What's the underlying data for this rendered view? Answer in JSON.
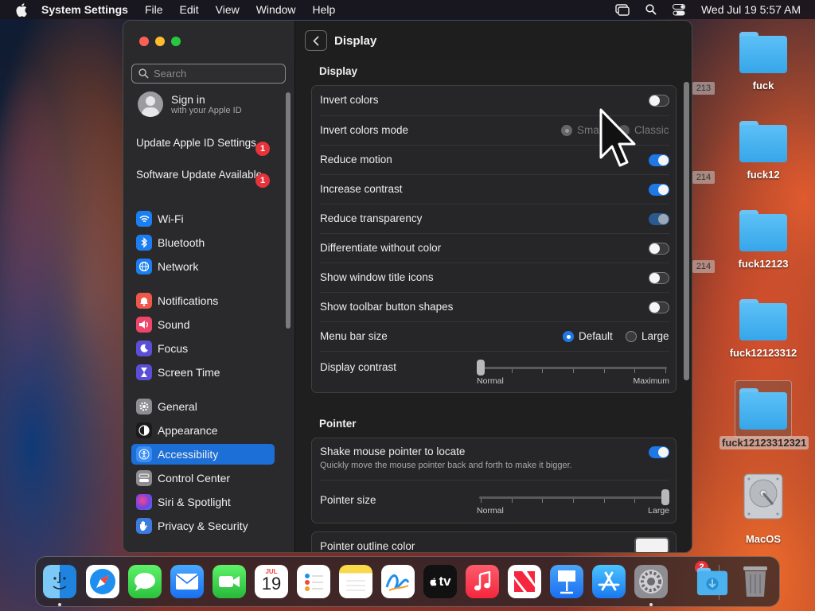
{
  "menubar": {
    "app": "System Settings",
    "items": [
      "File",
      "Edit",
      "View",
      "Window",
      "Help"
    ],
    "datetime": "Wed Jul 19  5:57 AM"
  },
  "desktop": {
    "icons": [
      {
        "label": "fuck"
      },
      {
        "label": "fuck12"
      },
      {
        "label": "fuck12123"
      },
      {
        "label": "fuck12123312"
      },
      {
        "label": "fuck12123312321",
        "selected": true
      },
      {
        "label": "MacOS",
        "type": "drive"
      }
    ],
    "peek_numbers": [
      "213",
      "214",
      "214"
    ]
  },
  "window": {
    "title": "Display"
  },
  "sidebar": {
    "search_placeholder": "Search",
    "signin": {
      "title": "Sign in",
      "subtitle": "with your Apple ID"
    },
    "updates": [
      {
        "label": "Update Apple ID Settings",
        "badge": "1"
      },
      {
        "label": "Software Update Available",
        "badge": "1"
      }
    ],
    "items": [
      {
        "label": "Wi-Fi",
        "icon": "wifi-icon",
        "color": "#1c7ef0"
      },
      {
        "label": "Bluetooth",
        "icon": "bluetooth-icon",
        "color": "#1c7ef0"
      },
      {
        "label": "Network",
        "icon": "globe-icon",
        "color": "#1c7ef0"
      },
      {
        "label": "Notifications",
        "icon": "bell-icon",
        "color": "#f0574b"
      },
      {
        "label": "Sound",
        "icon": "speaker-icon",
        "color": "#f0456a"
      },
      {
        "label": "Focus",
        "icon": "moon-icon",
        "color": "#5b4fd6"
      },
      {
        "label": "Screen Time",
        "icon": "hourglass-icon",
        "color": "#5b4fd6"
      },
      {
        "label": "General",
        "icon": "gear-icon",
        "color": "#8d8d92"
      },
      {
        "label": "Appearance",
        "icon": "appearance-icon",
        "color": "#1b1b1b"
      },
      {
        "label": "Accessibility",
        "icon": "accessibility-icon",
        "color": "#1c7ef0",
        "active": true
      },
      {
        "label": "Control Center",
        "icon": "control-center-icon",
        "color": "#8d8d92"
      },
      {
        "label": "Siri & Spotlight",
        "icon": "siri-icon",
        "color": "#9a3fd8"
      },
      {
        "label": "Privacy & Security",
        "icon": "hand-icon",
        "color": "#3e7be0"
      }
    ]
  },
  "display": {
    "section_title": "Display",
    "rows": [
      {
        "label": "Invert colors",
        "type": "switch",
        "state": "off"
      },
      {
        "label": "Invert colors mode",
        "type": "radio",
        "options": [
          "Smart",
          "Classic"
        ],
        "selected": "Smart",
        "disabled": true
      },
      {
        "label": "Reduce motion",
        "type": "switch",
        "state": "on"
      },
      {
        "label": "Increase contrast",
        "type": "switch",
        "state": "on"
      },
      {
        "label": "Reduce transparency",
        "type": "switch",
        "state": "on-disabled"
      },
      {
        "label": "Differentiate without color",
        "type": "switch",
        "state": "off"
      },
      {
        "label": "Show window title icons",
        "type": "switch",
        "state": "off"
      },
      {
        "label": "Show toolbar button shapes",
        "type": "switch",
        "state": "off"
      },
      {
        "label": "Menu bar size",
        "type": "radio",
        "options": [
          "Default",
          "Large"
        ],
        "selected": "Default"
      },
      {
        "label": "Display contrast",
        "type": "slider",
        "min_label": "Normal",
        "max_label": "Maximum",
        "value": 0.0
      }
    ]
  },
  "pointer": {
    "section_title": "Pointer",
    "shake": {
      "label": "Shake mouse pointer to locate",
      "subtitle": "Quickly move the mouse pointer back and forth to make it bigger.",
      "state": "on"
    },
    "size": {
      "label": "Pointer size",
      "min_label": "Normal",
      "max_label": "Large",
      "value": 1.0
    },
    "outline": {
      "label": "Pointer outline color",
      "color": "#ffffff"
    }
  },
  "dock": {
    "items": [
      "Finder",
      "Safari",
      "Messages",
      "Mail",
      "FaceTime",
      "Calendar",
      "Reminders",
      "Notes",
      "Freeform",
      "TV",
      "Music",
      "News",
      "Keynote",
      "App Store",
      "System Settings",
      "Downloads",
      "Trash"
    ],
    "calendar_month": "JUL",
    "calendar_day": "19",
    "tv_label": "tv",
    "settings_badge": "2"
  }
}
